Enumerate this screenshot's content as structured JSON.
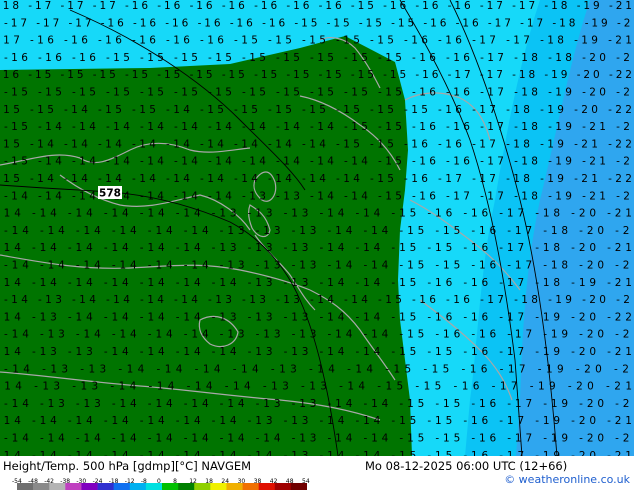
{
  "footer": {
    "title": "Height/Temp. 500 hPa [gdmp][°C] NAVGEM",
    "datetime": "Mo 08-12-2025 06:00 UTC (12+66)",
    "credit": "© weatheronline.co.uk"
  },
  "colors": {
    "green": "#007400",
    "light_cyan": "#16d9f9",
    "mid_cyan": "#0bc3f5",
    "blue": "#2fa6ef",
    "coast": "#a8a8a8",
    "contour": "#000000",
    "label": "#000000"
  },
  "isohypse_label": "578",
  "scale": {
    "labels": [
      "-54",
      "-48",
      "-42",
      "-38",
      "-30",
      "-24",
      "-18",
      "-12",
      "-8",
      "0",
      "8",
      "12",
      "18",
      "24",
      "30",
      "38",
      "42",
      "48",
      "54"
    ],
    "colors": [
      "#6f6f6f",
      "#8a8a8a",
      "#b4b4b4",
      "#c040c0",
      "#8000c0",
      "#3030d0",
      "#1070f0",
      "#00b0f0",
      "#00e0e0",
      "#00c000",
      "#008000",
      "#90d000",
      "#f0f000",
      "#f0b000",
      "#f07000",
      "#e01000",
      "#a00000",
      "#700000"
    ]
  },
  "temp_rows": [
    "-18 -17 -17 -17 -16 -16 -16 -16 -16 -16 -16 -15 -16 -16 -16 -17 -17 -18 -19 -21",
    "-17 -17 -17 -16 -16 -16 -16 -16 -16 -15 -15 -15 -15 -16 -16 -17 -17 -18 -19 -21",
    "-17 -16 -16 -16 -16 -16 -16 -15 -15 -15 -15 -15 -16 -16 -17 -17 -18 -19 -21",
    "-16 -16 -16 -15 -15 -15 -15 -15 -15 -15 -15 -15 -16 -16 -17 -18 -18 -20 -21",
    "-16 -15 -15 -15 -15 -15 -15 -15 -15 -15 -15 -15 -15 -16 -17 -17 -18 -19 -20 -22",
    "-15 -15 -15 -15 -15 -15 -15 -15 -15 -15 -15 -15 -16 -16 -17 -18 -19 -20 -22",
    "-15 -15 -14 -15 -15 -14 -15 -15 -15 -15 -15 -15 -15 -16 -17 -18 -19 -20 -22",
    "-15 -14 -14 -14 -14 -14 -14 -14 -14 -14 -15 -15 -16 -16 -17 -18 -19 -21 -22",
    "-15 -14 -14 -14 -14 -14 -14 -14 -14 -14 -15 -15 -16 -16 -17 -18 -19 -21 -22",
    "-15 -14 -14 -14 -14 -14 -14 -14 -14 -14 -14 -15 -16 -16 -17 -18 -19 -21 -22",
    "-15 -14 -14 -14 -14 -14 -14 -14 -14 -14 -14 -15 -16 -17 -17 -18 -19 -21 -22",
    "-14 -14 -14 -14 -14 -14 -14 -13 -13 -14 -14 -15 -16 -17 -17 -18 -19 -21 -22",
    "-14 -14 -14 -14 -14 -14 -13 -13 -13 -14 -14 -15 -16 -16 -17 -18 -20 -21",
    "-14 -14 -14 -14 -14 -14 -13 -13 -13 -14 -14 -15 -15 -16 -17 -18 -20 -21",
    "-14 -14 -14 -14 -14 -14 -13 -13 -13 -14 -14 -15 -15 -16 -17 -18 -20 -21",
    "-14 -14 -14 -14 -14 -14 -13 -13 -13 -14 -14 -15 -15 -16 -17 -18 -20 -21",
    "-14 -14 -14 -14 -14 -14 -14 -13 -13 -14 -14 -15 -16 -16 -17 -18 -19 -21",
    "-14 -13 -14 -14 -14 -14 -13 -13 -13 -14 -14 -15 -16 -16 -17 -18 -19 -20 -22",
    "-14 -13 -14 -14 -14 -14 -13 -13 -13 -14 -14 -15 -16 -16 -17 -19 -20 -22",
    "-14 -13 -14 -14 -14 -14 -13 -13 -13 -14 -14 -15 -16 -16 -17 -19 -20 -21",
    "-14 -13 -13 -14 -14 -14 -14 -13 -13 -14 -14 -15 -15 -16 -17 -19 -20 -21",
    "-14 -13 -13 -14 -14 -14 -14 -13 -14 -14 -15 -15 -16 -17 -19 -20 -21",
    "-14 -13 -13 -14 -14 -14 -14 -13 -13 -14 -15 -15 -16 -17 -19 -20 -21",
    "-14 -13 -13 -14 -14 -14 -14 -13 -13 -14 -14 -15 -15 -16 -17 -19 -20 -21",
    "-14 -14 -14 -14 -14 -14 -14 -13 -13 -14 -14 -15 -15 -16 -17 -19 -20 -21",
    "-14 -14 -14 -14 -14 -14 -14 -14 -13 -14 -14 -15 -15 -16 -17 -19 -20 -21",
    "-14 -14 -14 -14 -14 -14 -14 -14 -13 -14 -14 -15 -15 -16 -17 -19 -20 -21"
  ]
}
